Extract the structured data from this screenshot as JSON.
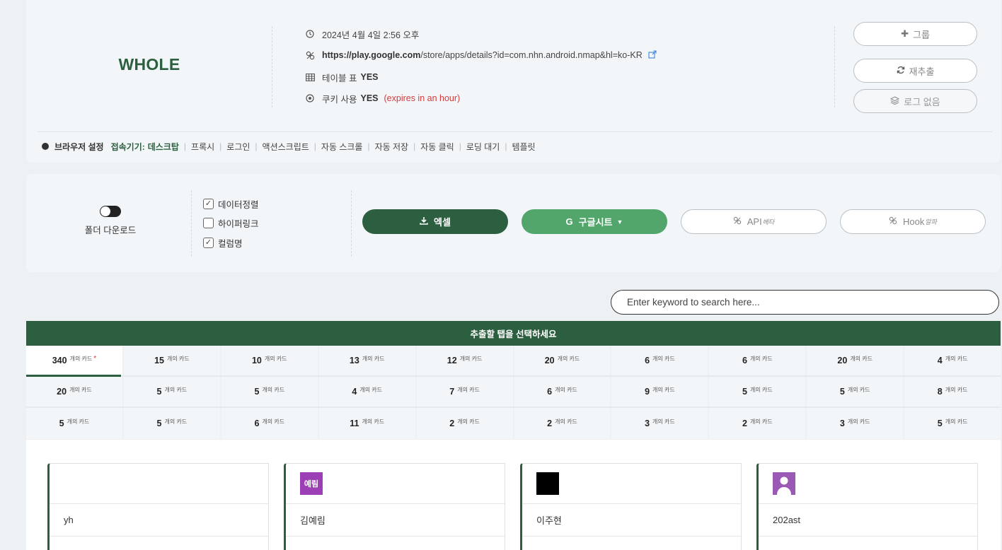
{
  "header": {
    "title": "WHOLE",
    "datetime": "2024년 4월 4일 2:56 오후",
    "url_host": "https://play.google.com",
    "url_path": "/store/apps/details?id=com.nhn.android.nmap&hl=ko-KR",
    "table_label": "테이블 표",
    "table_value": "YES",
    "cookie_label": "쿠키 사용",
    "cookie_value": "YES",
    "cookie_expires": "(expires in an hour)",
    "buttons": {
      "group": "그룹",
      "reextract": "재추출",
      "no_log": "로그 없음"
    }
  },
  "browser": {
    "settings_label": "브라우저 설정",
    "connector_label": "접속기기:",
    "connector_value": "데스크탑",
    "options": [
      "프록시",
      "로그인",
      "액션스크립트",
      "자동 스크롤",
      "자동 저장",
      "자동 클릭",
      "로딩 대기",
      "템플릿"
    ]
  },
  "export": {
    "folder_download_label": "폴더 다운로드",
    "folder_download_on": false,
    "checkboxes": [
      {
        "label": "데이터정렬",
        "checked": true
      },
      {
        "label": "하이퍼링크",
        "checked": false
      },
      {
        "label": "컬럼명",
        "checked": true
      }
    ],
    "excel_label": "엑셀",
    "gsheet_label": "구글시트",
    "api_label": "API",
    "api_badge": "베타",
    "hook_label": "Hook",
    "hook_badge": "알파"
  },
  "search": {
    "placeholder": "Enter keyword to search here..."
  },
  "tabs": {
    "heading": "추출할 탭을 선택하세요",
    "unit": "개의 카드",
    "rows": [
      [
        "340",
        "15",
        "10",
        "13",
        "12",
        "20",
        "6",
        "6",
        "20",
        "4"
      ],
      [
        "20",
        "5",
        "5",
        "4",
        "7",
        "6",
        "9",
        "5",
        "5",
        "8"
      ],
      [
        "5",
        "5",
        "6",
        "11",
        "2",
        "2",
        "3",
        "2",
        "3",
        "5"
      ]
    ],
    "active_index": 0,
    "active_marker": "*"
  },
  "cards": [
    {
      "name": "yh",
      "avatar_type": "none",
      "avatar_text": ""
    },
    {
      "name": "김예림",
      "avatar_type": "text",
      "avatar_text": "예림"
    },
    {
      "name": "이주현",
      "avatar_type": "black",
      "avatar_text": ""
    },
    {
      "name": "202ast",
      "avatar_type": "person",
      "avatar_text": ""
    }
  ],
  "colors": {
    "brand_dark": "#2c5f3f",
    "brand_light": "#52a56b",
    "alert": "#d23b3b",
    "link_icon": "#3b82d6"
  }
}
